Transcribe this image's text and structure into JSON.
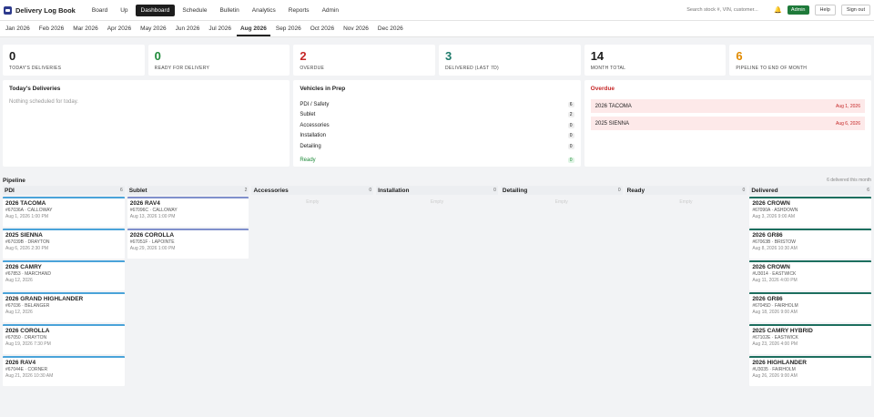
{
  "brand": "Delivery Log Book",
  "nav": [
    "Board",
    "Up",
    "Dashboard",
    "Schedule",
    "Bulletin",
    "Analytics",
    "Reports",
    "Admin"
  ],
  "nav_active": 2,
  "search_placeholder": "Search stock #, VIN, customer...",
  "role": "Admin",
  "help_label": "Help",
  "signout_label": "Sign out",
  "months": [
    "Jan 2026",
    "Feb 2026",
    "Mar 2026",
    "Apr 2026",
    "May 2026",
    "Jun 2026",
    "Jul 2026",
    "Aug 2026",
    "Sep 2026",
    "Oct 2026",
    "Nov 2026",
    "Dec 2026"
  ],
  "month_active": 7,
  "stats": [
    {
      "value": "0",
      "label": "TODAY'S DELIVERIES",
      "color": "#1d1d1d"
    },
    {
      "value": "0",
      "label": "READY FOR DELIVERY",
      "color": "#1f8a3a"
    },
    {
      "value": "2",
      "label": "OVERDUE",
      "color": "#c62828"
    },
    {
      "value": "3",
      "label": "DELIVERED (LAST 7D)",
      "color": "#1d7a6a"
    },
    {
      "value": "14",
      "label": "MONTH TOTAL",
      "color": "#1d1d1d"
    },
    {
      "value": "6",
      "label": "PIPELINE TO END OF MONTH",
      "color": "#e08a00"
    }
  ],
  "today": {
    "title": "Today's Deliveries",
    "empty": "Nothing scheduled for today."
  },
  "prep": {
    "title": "Vehicles in Prep",
    "rows": [
      {
        "label": "PDI / Safety",
        "count": "6"
      },
      {
        "label": "Sublet",
        "count": "2"
      },
      {
        "label": "Accessories",
        "count": "0"
      },
      {
        "label": "Installation",
        "count": "0"
      },
      {
        "label": "Detailing",
        "count": "0"
      }
    ],
    "ready_label": "Ready",
    "ready_count": "0"
  },
  "overdue": {
    "title": "Overdue",
    "rows": [
      {
        "vehicle": "2026 TACOMA",
        "date": "Aug 1, 2026"
      },
      {
        "vehicle": "2025 SIENNA",
        "date": "Aug 6, 2026"
      }
    ]
  },
  "pipeline": {
    "title": "Pipeline",
    "note": "6 delivered this month",
    "empty_label": "Empty",
    "columns": [
      {
        "name": "PDI",
        "count": "6",
        "kind": "pdi",
        "cards": [
          {
            "title": "2026 TACOMA",
            "sub": "#67036A · CALLOWAY",
            "date": "Aug 1, 2026 1:00 PM"
          },
          {
            "title": "2025 SIENNA",
            "sub": "#67039B · DRAYTON",
            "date": "Aug 6, 2026 2:30 PM"
          },
          {
            "title": "2026 CAMRY",
            "sub": "#67853 · MARCHAND",
            "date": "Aug 12, 2026"
          },
          {
            "title": "2026 GRAND HIGHLANDER",
            "sub": "#67036 · BELANGER",
            "date": "Aug 12, 2026"
          },
          {
            "title": "2026 COROLLA",
            "sub": "#67050 · DRAYTON",
            "date": "Aug 19, 2026 7:30 PM"
          },
          {
            "title": "2026 RAV4",
            "sub": "#67044E · CORNER",
            "date": "Aug 21, 2026 10:30 AM"
          }
        ]
      },
      {
        "name": "Sublet",
        "count": "2",
        "kind": "sublet",
        "cards": [
          {
            "title": "2026 RAV4",
            "sub": "#67096C · CALLOWAY",
            "date": "Aug 13, 2026 1:00 PM"
          },
          {
            "title": "2026 COROLLA",
            "sub": "#67051F · LAPOINTE",
            "date": "Aug 29, 2026 1:00 PM"
          }
        ]
      },
      {
        "name": "Accessories",
        "count": "0",
        "kind": "empty",
        "cards": []
      },
      {
        "name": "Installation",
        "count": "0",
        "kind": "empty",
        "cards": []
      },
      {
        "name": "Detailing",
        "count": "0",
        "kind": "empty",
        "cards": []
      },
      {
        "name": "Ready",
        "count": "0",
        "kind": "empty",
        "cards": []
      },
      {
        "name": "Delivered",
        "count": "6",
        "kind": "delivered",
        "cards": [
          {
            "title": "2026 CROWN",
            "sub": "#67090A · ASHDOWN",
            "date": "Aug 3, 2026 9:00 AM"
          },
          {
            "title": "2026 GR86",
            "sub": "#67063B · BRISTOW",
            "date": "Aug 8, 2026 10:30 AM"
          },
          {
            "title": "2026 CROWN",
            "sub": "#U3014 · EASTWICK",
            "date": "Aug 11, 2026 4:00 PM"
          },
          {
            "title": "2026 GR86",
            "sub": "#67045D · FAIRHOLM",
            "date": "Aug 18, 2026 9:00 AM"
          },
          {
            "title": "2025 CAMRY HYBRID",
            "sub": "#67102E · EASTWICK",
            "date": "Aug 23, 2026 4:00 PM"
          },
          {
            "title": "2026 HIGHLANDER",
            "sub": "#U3035 · FAIRHOLM",
            "date": "Aug 26, 2026 9:00 AM"
          }
        ]
      }
    ]
  }
}
